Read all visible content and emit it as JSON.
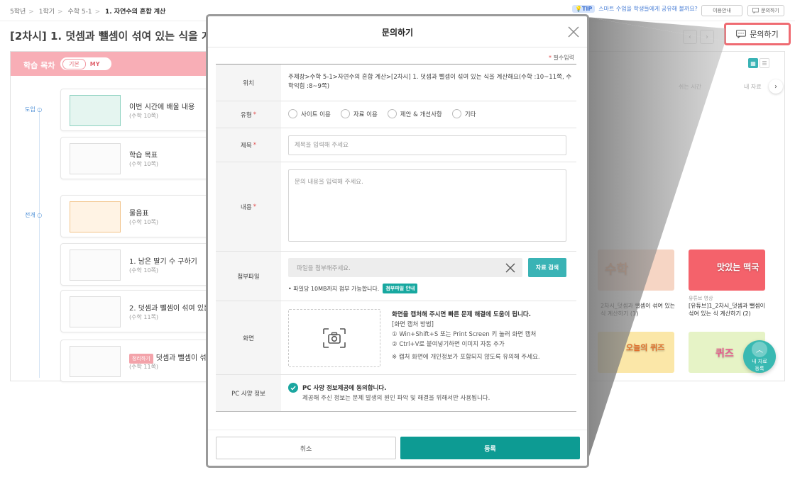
{
  "breadcrumb": {
    "items": [
      "5학년",
      "1학기",
      "수학 5-1"
    ],
    "current": "1. 자연수의 혼합 계산"
  },
  "tip": {
    "badge": "TIP",
    "text": "스마트 수업을 학생들에게 공유해 볼까요?"
  },
  "top_buttons": {
    "usage_guide": "이용안내",
    "inquiry": "문의하기"
  },
  "page_title": "[2차시] 1. 덧셈과 뺄셈이 섞여 있는 식을 계산",
  "inquiry_button_label": "문의하기",
  "toc": {
    "label": "학습 목차",
    "toggle_basic": "기본",
    "toggle_my": "MY",
    "stages": [
      "도입",
      "전개"
    ],
    "lessons": [
      {
        "title": "이번 시간에 배울 내용",
        "sub": "(수학 10쪽)",
        "badge": ""
      },
      {
        "title": "학습 목표",
        "sub": "(수학 10쪽)",
        "badge": ""
      },
      {
        "title": "물음표",
        "sub": "(수학 10쪽)",
        "badge": ""
      },
      {
        "title": "1. 남은 딸기 수 구하기",
        "sub": "(수학 10쪽)",
        "badge": ""
      },
      {
        "title": "2. 덧셈과 뺄셈이 섞여 있는 식을",
        "sub": "(수학 11쪽)",
        "badge": ""
      },
      {
        "title": "덧셈과 뺄셈이 섞여 있는",
        "sub": "(수학 11쪽)",
        "badge": "정리하기"
      }
    ]
  },
  "media_tabs": [
    "쉬는 시간",
    "내 자료"
  ],
  "media": [
    {
      "sub": "",
      "title": "2차시_덧셈과 뺄셈이 섞여 있는 식 계산하기 (1)",
      "thumb_text": "수학"
    },
    {
      "sub": "유튜브 영상",
      "title": "[유튜브]1_2차시_덧셈과 뺄셈이 섞여 있는 식 계산하기 (2)",
      "thumb_text": "맛있는 떡국"
    },
    {
      "sub": "",
      "title": "",
      "thumb_text": "오늘의 퀴즈"
    },
    {
      "sub": "",
      "title": "",
      "thumb_text": "퀴즈"
    }
  ],
  "fab": {
    "line1": "내 자료",
    "line2": "등록"
  },
  "modal": {
    "title": "문의하기",
    "required_note": "필수입력",
    "required_star": "*",
    "location": {
      "label": "위치",
      "value": "주제창>수학 5-1>자연수의 혼합 계산>[2차시] 1. 덧셈과 뺄셈이 섞여 있는 식을 계산해요(수학 :10~11쪽, 수학익힘 :8~9쪽)"
    },
    "type": {
      "label": "유형",
      "options": [
        "사이트 이용",
        "자료 이용",
        "제안 & 개선사항",
        "기타"
      ]
    },
    "subject": {
      "label": "제목",
      "value": "",
      "placeholder": "제목을 입력해 주세요"
    },
    "content": {
      "label": "내용",
      "value": "",
      "placeholder": "문의 내용을 입력해 주세요."
    },
    "attachment": {
      "label": "첨부파일",
      "placeholder": "파일을 첨부해주세요.",
      "search_button": "자료 검색",
      "note": "• 파일당 10MB까지 첨부 가능합니다.",
      "guide_badge": "첨부파일 안내"
    },
    "screen": {
      "label": "화면",
      "lead": "화면을 캡처해 주시면 빠른 문제 해결에 도움이 됩니다.",
      "method_title": "[화면 캡처 방법]",
      "step1": "① Win+Shift+S 또는 Print Screen 키 눌러 화면 캡처",
      "step2": "② Ctrl+V로 붙여넣기하면 이미지 자동 추가",
      "caution": "※ 캡처 화면에 개인정보가 포함되지 않도록 유의해 주세요."
    },
    "pc_info": {
      "label": "PC 사양 정보",
      "agree": "PC 사양 정보제공에 동의합니다.",
      "desc": "제공해 주신 정보는 문제 발생의 원인 파악 및 해결을 위해서만 사용됩니다."
    },
    "buttons": {
      "cancel": "취소",
      "submit": "등록"
    }
  },
  "colors": {
    "accent_teal": "#0d9b93",
    "highlight_red": "#ef6b72",
    "toc_pink": "#f8aeb6",
    "required_red": "#e14c4c"
  }
}
